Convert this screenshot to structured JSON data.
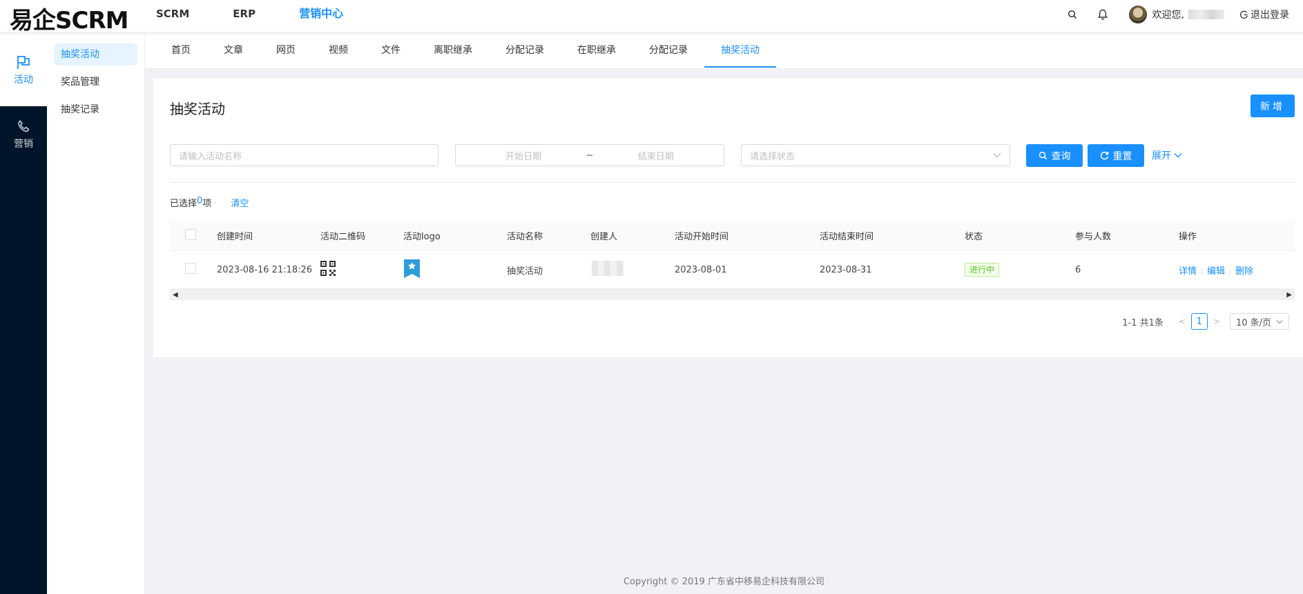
{
  "app": {
    "logo": "易企SCRM"
  },
  "topnav": [
    {
      "label": "SCRM"
    },
    {
      "label": "ERP"
    },
    {
      "label": "营销中心"
    }
  ],
  "header": {
    "welcome": "欢迎您,",
    "logout": "退出登录"
  },
  "rail": {
    "items": [
      {
        "label": "活动"
      },
      {
        "label": "营销"
      }
    ]
  },
  "sidebar": {
    "items": [
      {
        "label": "抽奖活动"
      },
      {
        "label": "奖品管理"
      },
      {
        "label": "抽奖记录"
      }
    ]
  },
  "tabs": [
    {
      "label": "首页"
    },
    {
      "label": "文章"
    },
    {
      "label": "网页"
    },
    {
      "label": "视频"
    },
    {
      "label": "文件"
    },
    {
      "label": "离职继承"
    },
    {
      "label": "分配记录"
    },
    {
      "label": "在职继承"
    },
    {
      "label": "分配记录"
    },
    {
      "label": "抽奖活动"
    }
  ],
  "page": {
    "title": "抽奖活动",
    "new_label": "新增"
  },
  "filters": {
    "name_placeholder": "请输入活动名称",
    "start_date_placeholder": "开始日期",
    "date_separator": "~",
    "end_date_placeholder": "结束日期",
    "status_placeholder": "请选择状态",
    "query_label": "查询",
    "reset_label": "重置",
    "expand_label": "展开"
  },
  "selection": {
    "prefix": "已选择 ",
    "count": "0",
    "suffix": "项",
    "clear_label": "清空"
  },
  "table": {
    "columns": [
      "创建时间",
      "活动二维码",
      "活动logo",
      "活动名称",
      "创建人",
      "活动开始时间",
      "活动结束时间",
      "状态",
      "参与人数",
      "操作"
    ],
    "rows": [
      {
        "created": "2023-08-16 21:18:26",
        "name": "抽奖活动",
        "start": "2023-08-01",
        "end": "2023-08-31",
        "status": "进行中",
        "participants": "6",
        "ops": [
          "详情",
          "编辑",
          "删除"
        ]
      }
    ]
  },
  "pagination": {
    "total": "1-1 共1条",
    "current_page": "1",
    "page_size": "10 条/页"
  },
  "footer": {
    "copyright": "Copyright © 2019 广东省中移易企科技有限公司"
  },
  "colors": {
    "primary": "#1890ff",
    "rail": "#001529",
    "status_green": "#52c41a"
  }
}
